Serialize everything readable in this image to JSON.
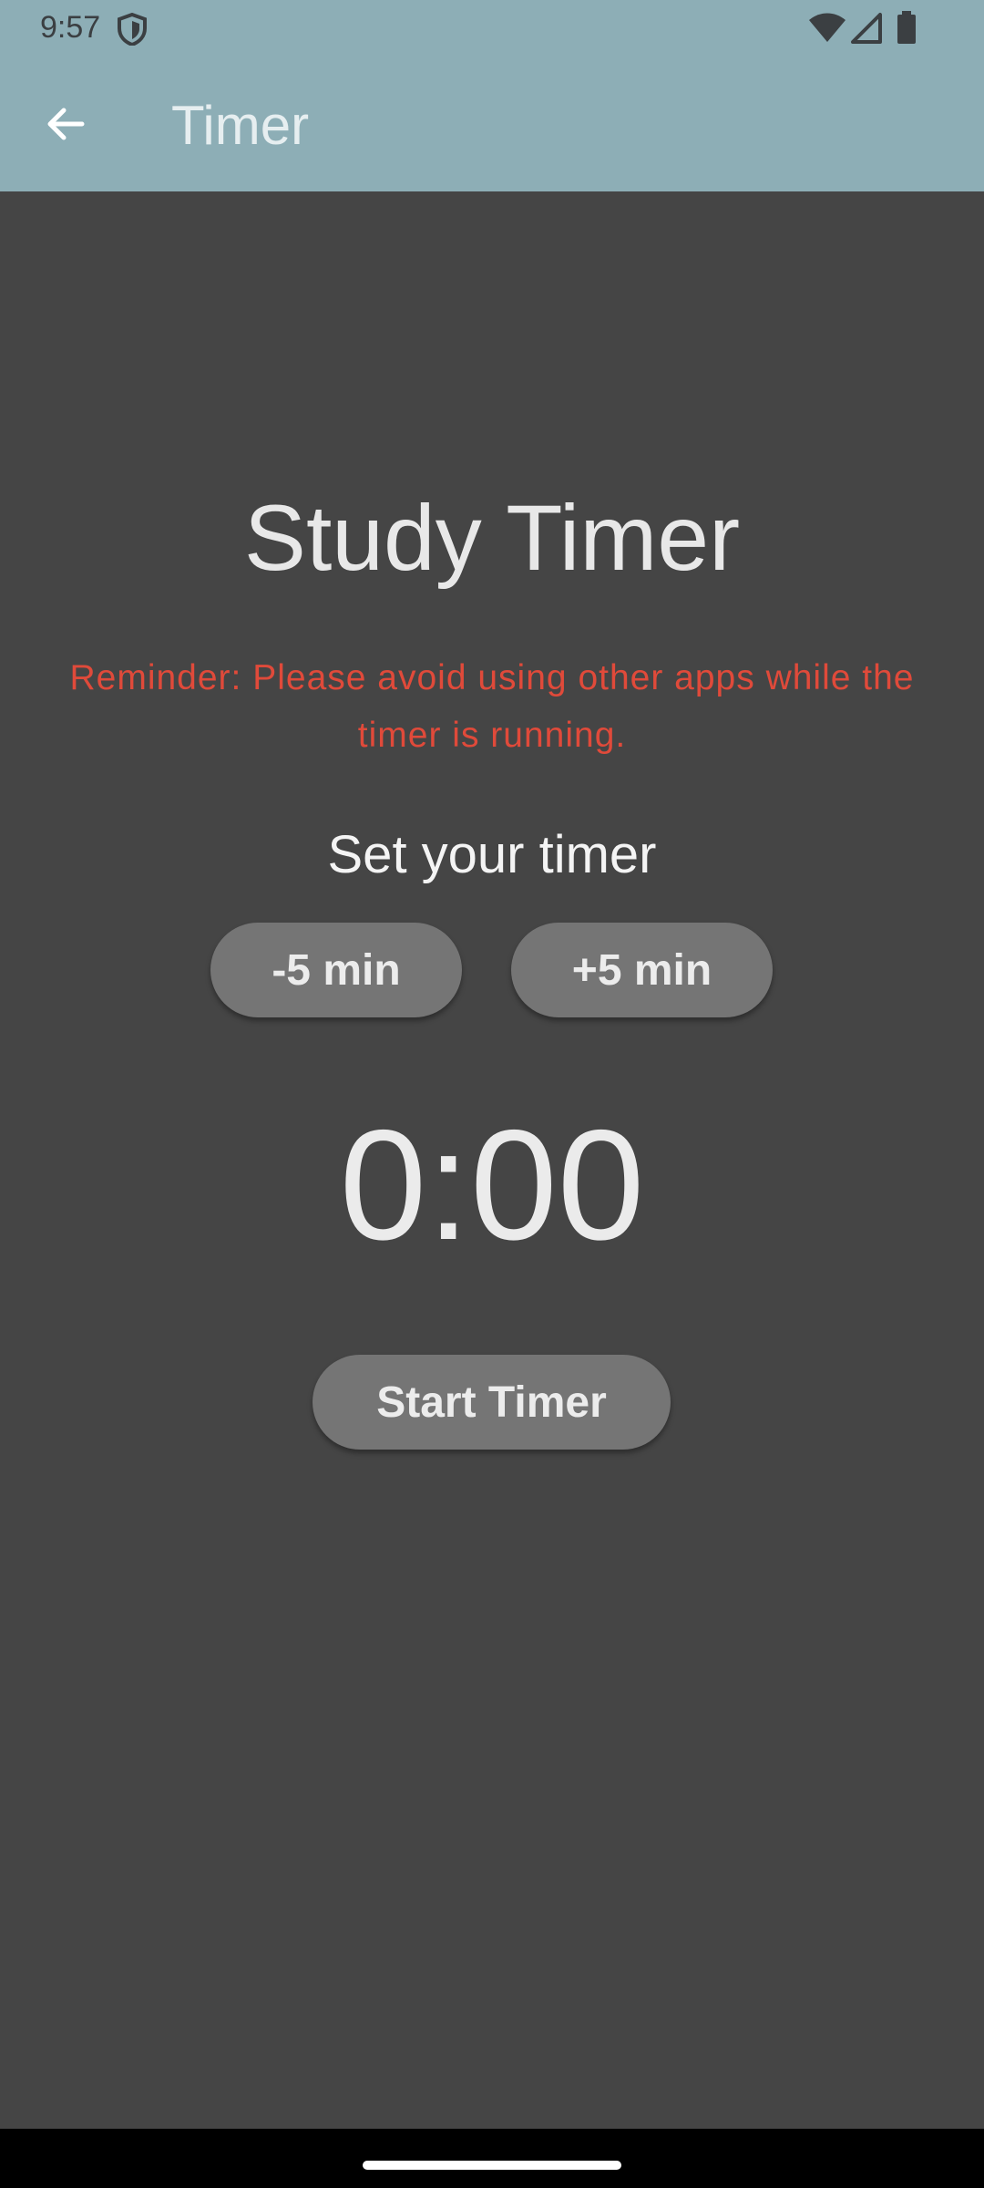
{
  "status_bar": {
    "time": "9:57",
    "icons": [
      "shield-icon",
      "wifi-icon",
      "signal-icon",
      "battery-icon"
    ]
  },
  "app_bar": {
    "title": "Timer",
    "back_icon": "arrow-left-icon"
  },
  "main": {
    "heading": "Study Timer",
    "reminder": "Reminder: Please avoid using other apps while the timer is running.",
    "set_label": "Set your timer",
    "decrease_label": "-5 min",
    "increase_label": "+5 min",
    "timer_value": "0:00",
    "start_label": "Start Timer"
  },
  "colors": {
    "app_bar": "#8daeb6",
    "background": "#454545",
    "button": "#757575",
    "reminder": "#e04a3a"
  }
}
